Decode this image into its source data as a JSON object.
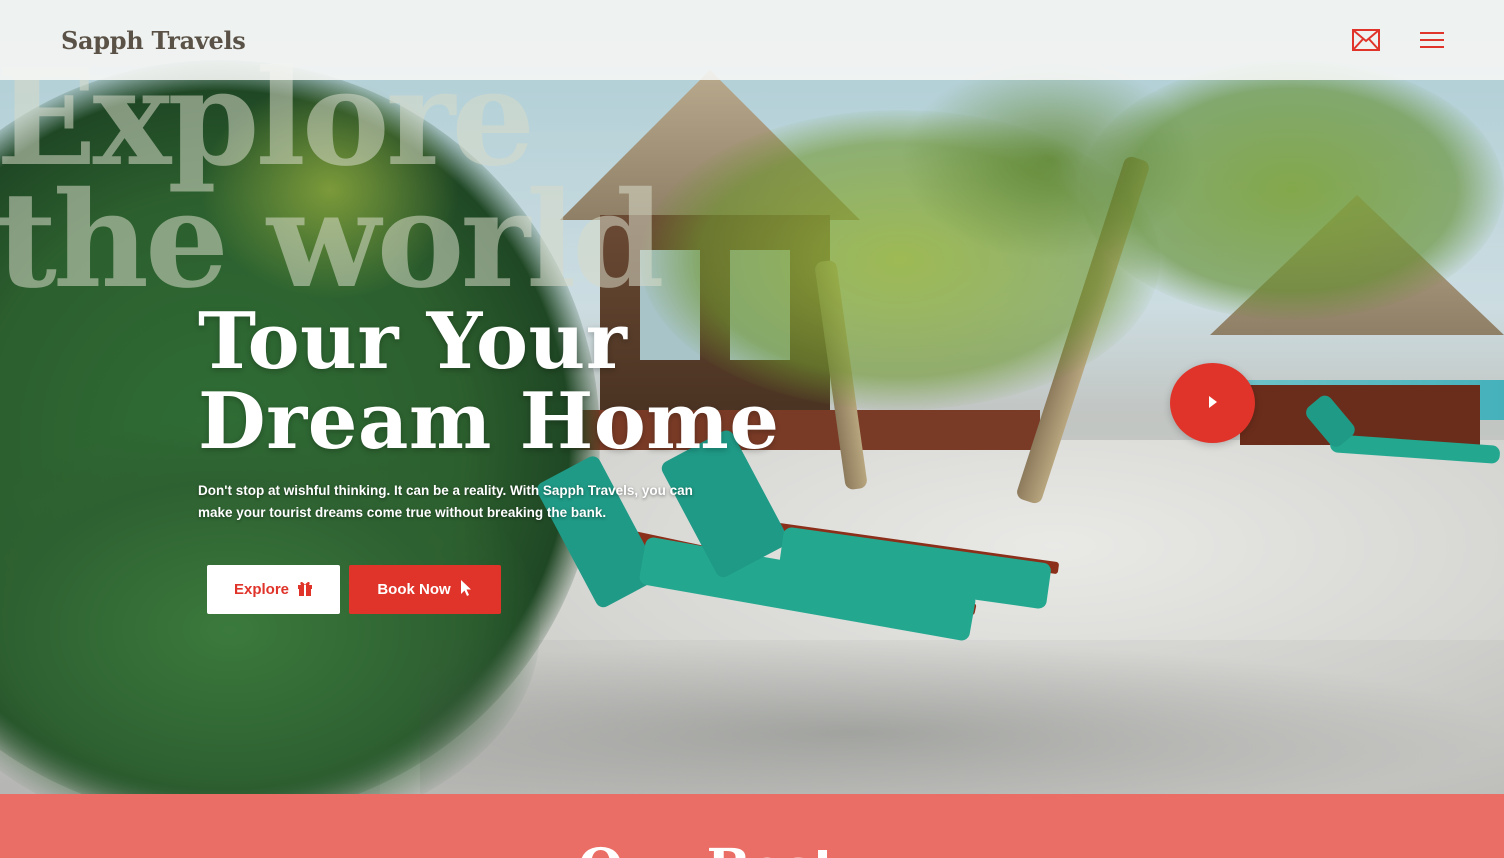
{
  "header": {
    "logo": "Sapph Travels",
    "icons": [
      "mail-icon",
      "menu-icon"
    ],
    "accent_color": "#e0342a"
  },
  "hero": {
    "background_words": [
      "Explore",
      "the world"
    ],
    "headline_line1": "Tour Your",
    "headline_line2": "Dream Home",
    "subtext": "Don't stop at wishful thinking. It can be a reality. With Sapph Travels, you can make your tourist dreams come true without breaking the bank.",
    "buttons": {
      "explore_label": "Explore",
      "explore_icon": "gift-icon",
      "book_label": "Book Now",
      "book_icon": "cursor-icon"
    },
    "play_icon": "play-icon"
  },
  "next_section": {
    "title": "Our Best",
    "background_color": "#ea6e65"
  }
}
